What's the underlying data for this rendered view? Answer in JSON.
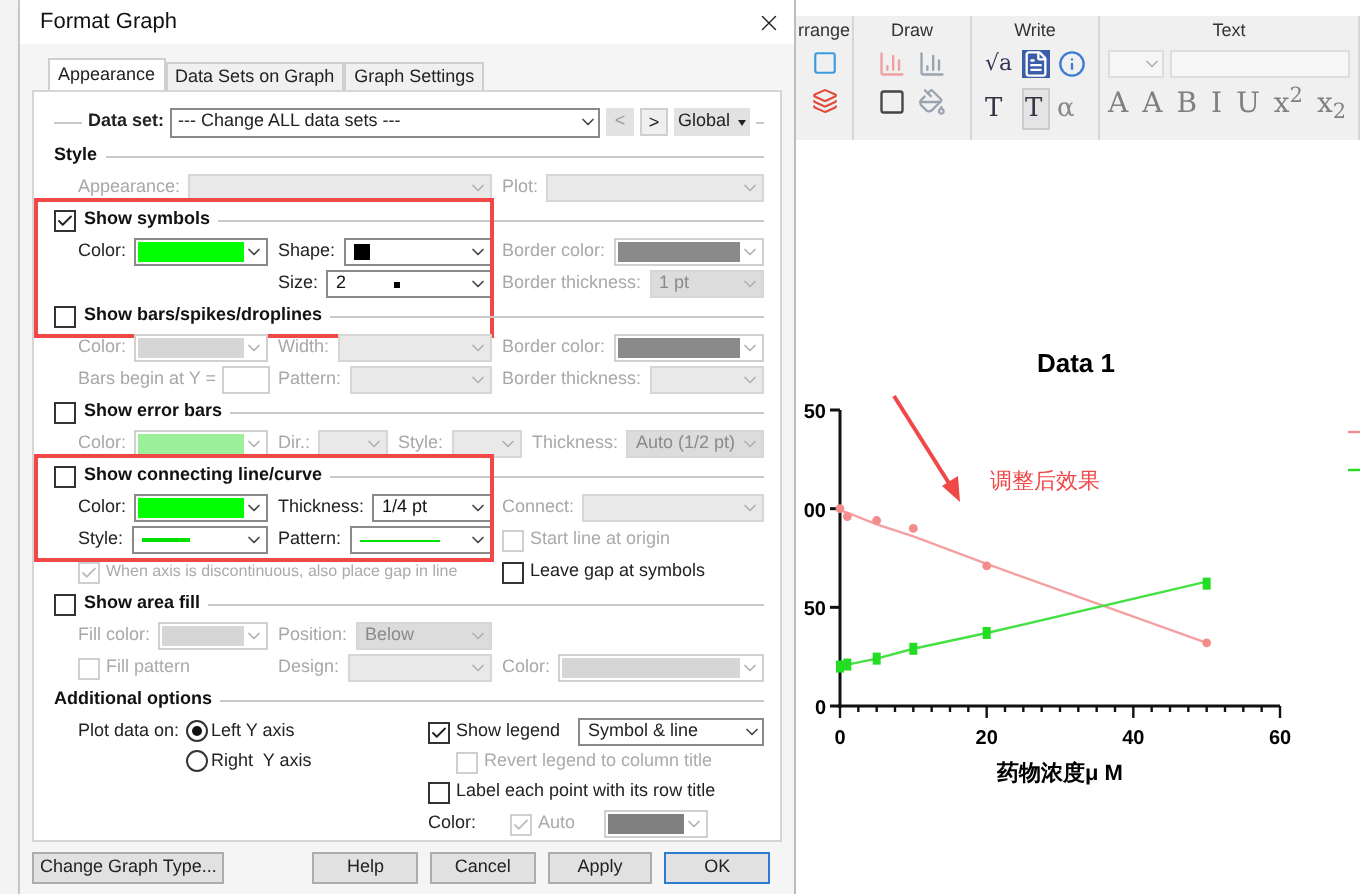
{
  "window": {
    "title": "Format Graph"
  },
  "tabs": [
    {
      "label": "Appearance",
      "selected": true
    },
    {
      "label": "Data Sets on Graph",
      "selected": false
    },
    {
      "label": "Graph Settings",
      "selected": false
    }
  ],
  "data_set": {
    "label": "Data set:",
    "value": "--- Change ALL data sets ---",
    "prev": "<",
    "next": ">",
    "scope": "Global"
  },
  "sections": [
    {
      "title": "Style",
      "kind": "heading",
      "highlighted": false,
      "rows": [
        [
          {
            "kind": "dropdown",
            "label": "Appearance:",
            "disabled": true,
            "colspan": 2
          },
          {
            "kind": "dropdown",
            "label": "Plot:",
            "disabled": true
          }
        ]
      ]
    },
    {
      "title": "Show symbols",
      "kind": "toggle",
      "checked": true,
      "highlighted": true,
      "rows": [
        [
          {
            "kind": "swatch",
            "label": "Color:",
            "color": "#00ff00",
            "disabled": false
          },
          {
            "kind": "dropdown",
            "label": "Shape:",
            "preview": {
              "kind": "square",
              "color": "#000000"
            },
            "disabled": false
          },
          {
            "kind": "swatch",
            "label": "Border color:",
            "color": "#8a8a8a",
            "disabled": true
          }
        ],
        [
          "",
          {
            "kind": "dropdown",
            "label": "Size:",
            "value": "2",
            "preview": {
              "kind": "dot",
              "color": "#000000"
            },
            "disabled": false
          },
          {
            "kind": "dropdown",
            "label": "Border thickness:",
            "value": "1 pt",
            "disabled": true
          }
        ]
      ]
    },
    {
      "title": "Show bars/spikes/droplines",
      "kind": "toggle",
      "checked": false,
      "highlighted": false,
      "rows": [
        [
          {
            "kind": "swatch",
            "label": "Color:",
            "color": "#d6d6d6",
            "disabled": true
          },
          {
            "kind": "dropdown",
            "label": "Width:",
            "disabled": true
          },
          {
            "kind": "swatch",
            "label": "Border color:",
            "color": "#8a8a8a",
            "disabled": true
          }
        ],
        [
          {
            "kind": "text",
            "label": "Bars begin at Y =",
            "disabled": true
          },
          {
            "kind": "dropdown",
            "label": "Pattern:",
            "disabled": true
          },
          {
            "kind": "dropdown",
            "label": "Border thickness:",
            "disabled": true
          }
        ]
      ]
    },
    {
      "title": "Show error bars",
      "kind": "toggle",
      "checked": false,
      "highlighted": false,
      "rows": [
        [
          {
            "kind": "swatch",
            "label": "Color:",
            "color": "#9cf09c",
            "disabled": true
          },
          {
            "kind": "dropdown",
            "label": "Dir.:",
            "disabled": true
          },
          {
            "kind": "dropdown",
            "label": "Style:",
            "disabled": true
          },
          {
            "kind": "dropdown",
            "label": "Thickness:",
            "value": "Auto (1/2 pt)",
            "disabled": true
          }
        ]
      ]
    },
    {
      "title": "Show connecting line/curve",
      "kind": "toggle",
      "checked": false,
      "highlighted": true,
      "rows": [
        [
          {
            "kind": "swatch",
            "label": "Color:",
            "color": "#00ff00",
            "disabled": false
          },
          {
            "kind": "dropdown",
            "label": "Thickness:",
            "value": "1/4 pt",
            "disabled": false
          },
          {
            "kind": "dropdown",
            "label": "Connect:",
            "disabled": true
          }
        ],
        [
          {
            "kind": "dropdown",
            "label": "Style:",
            "preview": {
              "kind": "line",
              "color": "#00e000"
            },
            "disabled": false
          },
          {
            "kind": "dropdown",
            "label": "Pattern:",
            "preview": {
              "kind": "thin-line",
              "color": "#00e000"
            },
            "disabled": false
          },
          {
            "kind": "checkbox",
            "label": "Start line at origin",
            "checked": false,
            "disabled": true
          }
        ],
        [
          {
            "kind": "checkbox",
            "label": "When axis is discontinuous, also place gap in line",
            "checked": true,
            "disabled": true,
            "colspan": 2
          },
          {
            "kind": "checkbox",
            "label": "Leave gap at symbols",
            "checked": false,
            "disabled": false
          }
        ]
      ]
    },
    {
      "title": "Show area fill",
      "kind": "toggle",
      "checked": false,
      "highlighted": false,
      "rows": [
        [
          {
            "kind": "swatch",
            "label": "Fill color:",
            "color": "#d6d6d6",
            "disabled": true
          },
          {
            "kind": "dropdown",
            "label": "Position:",
            "value": "Below",
            "disabled": true
          },
          ""
        ],
        [
          {
            "kind": "checkbox",
            "label": "Fill pattern",
            "checked": false,
            "disabled": true
          },
          {
            "kind": "dropdown",
            "label": "Design:",
            "disabled": true
          },
          {
            "kind": "swatch",
            "label": "Color:",
            "color": "#d6d6d6",
            "disabled": true
          }
        ]
      ]
    }
  ],
  "additional": {
    "title": "Additional options",
    "plot_label": "Plot data on:",
    "axes": [
      {
        "label": "Left Y axis",
        "selected": true
      },
      {
        "label": "Right  Y axis",
        "selected": false
      }
    ],
    "legend": {
      "label": "Show legend",
      "checked": true,
      "value": "Symbol & line"
    },
    "revert": {
      "label": "Revert legend to column title",
      "checked": false,
      "disabled": true
    },
    "label_points": {
      "label": "Label each point with its row title",
      "checked": false,
      "disabled": false
    },
    "color": {
      "label": "Color:",
      "auto_label": "Auto",
      "auto_checked": true,
      "swatch": {
        "color": "#808080"
      }
    }
  },
  "buttons": [
    {
      "label": "Change Graph Type...",
      "default": false
    },
    {
      "label": "Help",
      "default": false
    },
    {
      "label": "Cancel",
      "default": false
    },
    {
      "label": "Apply",
      "default": false
    },
    {
      "label": "OK",
      "default": true
    }
  ],
  "ribbon": [
    {
      "title": "rrange",
      "kind": "arrange"
    },
    {
      "title": "Draw",
      "kind": "draw"
    },
    {
      "title": "Write",
      "kind": "write",
      "glyphs": [
        "√a",
        "T",
        "T",
        "α"
      ]
    },
    {
      "title": "Text",
      "kind": "text",
      "glyphs": [
        "A",
        "A",
        "B",
        "I",
        "U",
        "x$^{2}$",
        "x$_{2}$"
      ]
    }
  ],
  "graph": {
    "partial_tick_labels": [
      "50",
      "00"
    ],
    "chart_data": {
      "type": "scatter",
      "title": "Data 1",
      "xlabel": "药物浓度μ M",
      "x": [
        0,
        1,
        5,
        10,
        20,
        50
      ],
      "series": [
        {
          "color": "#f48c8c",
          "values": [
            100,
            96,
            94,
            90,
            71,
            32
          ]
        },
        {
          "color": "#22dd22",
          "values": [
            20,
            21,
            24,
            29,
            37,
            62
          ]
        },
        {
          "type": "line",
          "color": "#f4a0a0",
          "values": [
            99,
            98,
            92,
            86,
            72,
            32
          ]
        },
        {
          "type": "line",
          "color": "#44e044",
          "values": [
            20,
            21,
            24,
            29,
            37,
            63
          ]
        }
      ],
      "xlim": [
        0,
        60
      ],
      "ylim": [
        0,
        150
      ],
      "xticks": [
        0,
        20,
        40,
        60
      ],
      "yticks": [
        0,
        50
      ],
      "annotations": [
        {
          "text": "调整后效果"
        }
      ]
    }
  }
}
